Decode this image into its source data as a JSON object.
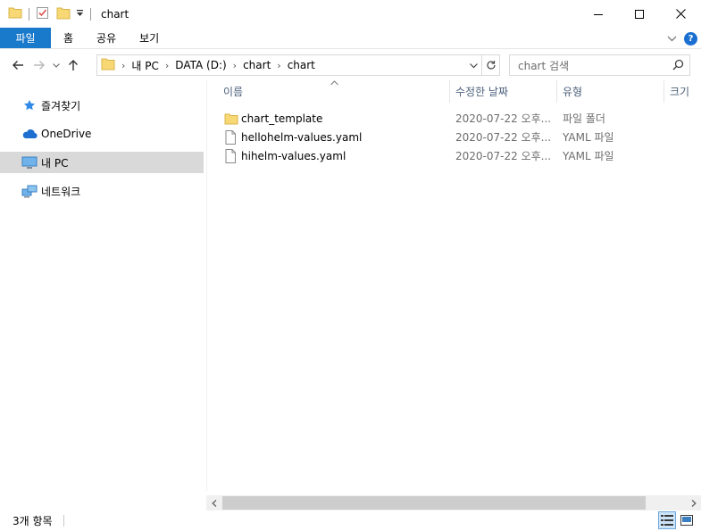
{
  "window": {
    "title": "chart",
    "qat_icons": [
      "folder-icon",
      "properties-checkmark-icon",
      "new-folder-icon",
      "customize-dropdown-icon"
    ],
    "controls": [
      "minimize-icon",
      "maximize-icon",
      "close-icon"
    ]
  },
  "ribbon": {
    "tabs": [
      "파일",
      "홈",
      "공유",
      "보기"
    ],
    "file_tab_color": "#1979ca",
    "right_icons": [
      "expand-ribbon-icon",
      "help-icon"
    ],
    "help_label": "?"
  },
  "nav": {
    "breadcrumbs": [
      "내 PC",
      "DATA (D:)",
      "chart",
      "chart"
    ],
    "search_placeholder": "chart 검색"
  },
  "sidebar": {
    "items": [
      {
        "label": "즐겨찾기",
        "icon": "star-icon",
        "selected": false
      },
      {
        "label": "OneDrive",
        "icon": "cloud-icon",
        "selected": false
      },
      {
        "label": "내 PC",
        "icon": "computer-icon",
        "selected": true
      },
      {
        "label": "네트워크",
        "icon": "network-icon",
        "selected": false
      }
    ]
  },
  "list": {
    "columns": [
      "이름",
      "수정한 날짜",
      "유형",
      "크기"
    ],
    "rows": [
      {
        "name": "chart_template",
        "date": "2020-07-22 오후...",
        "type": "파일 폴더",
        "icon": "folder-icon"
      },
      {
        "name": "hellohelm-values.yaml",
        "date": "2020-07-22 오후...",
        "type": "YAML 파일",
        "icon": "document-icon"
      },
      {
        "name": "hihelm-values.yaml",
        "date": "2020-07-22 오후...",
        "type": "YAML 파일",
        "icon": "document-icon"
      }
    ]
  },
  "status": {
    "item_count": "3개 항목"
  },
  "colors": {
    "accent": "#1979ca",
    "selected_bg": "#d9d9d9",
    "header_text": "#4c607a",
    "folder_yellow": "#f8d775"
  }
}
